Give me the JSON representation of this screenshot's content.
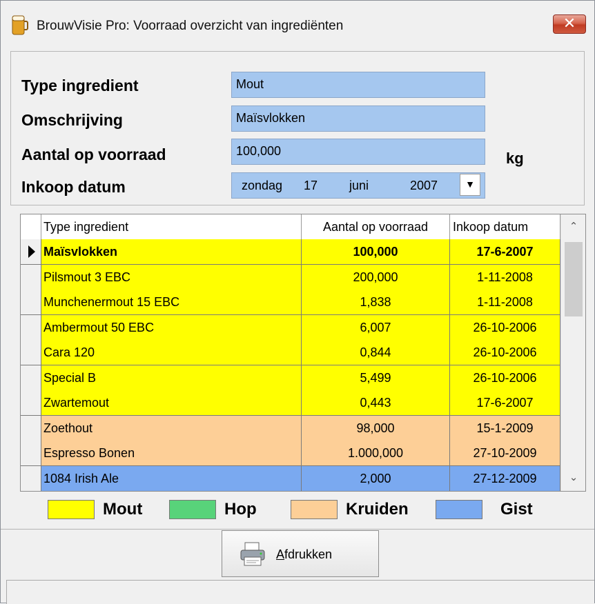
{
  "window": {
    "title": "BrouwVisie Pro: Voorraad overzicht van ingrediënten",
    "close_glyph": "✕"
  },
  "form": {
    "type_label": "Type ingredient",
    "type_value": "Mout",
    "desc_label": "Omschrijving",
    "desc_value": "Maïsvlokken",
    "qty_label": "Aantal op voorraad",
    "qty_value": "100,000",
    "qty_unit": "kg",
    "date_label": "Inkoop datum",
    "date": {
      "weekday": "zondag",
      "day": "17",
      "month": "juni",
      "year": "2007"
    }
  },
  "grid": {
    "columns": [
      "Type ingredient",
      "Aantal op voorraad",
      "Inkoop datum"
    ],
    "rows": [
      {
        "name": "Maïsvlokken",
        "qty": "100,000",
        "date": "17-6-2007",
        "category": "Mout",
        "selected": true
      },
      {
        "name": "Pilsmout 3 EBC",
        "qty": "200,000",
        "date": "1-11-2008",
        "category": "Mout"
      },
      {
        "name": "Munchenermout 15 EBC",
        "qty": "1,838",
        "date": "1-11-2008",
        "category": "Mout"
      },
      {
        "name": "Ambermout 50 EBC",
        "qty": "6,007",
        "date": "26-10-2006",
        "category": "Mout"
      },
      {
        "name": "Cara 120",
        "qty": "0,844",
        "date": "26-10-2006",
        "category": "Mout"
      },
      {
        "name": "Special B",
        "qty": "5,499",
        "date": "26-10-2006",
        "category": "Mout"
      },
      {
        "name": "Zwartemout",
        "qty": "0,443",
        "date": "17-6-2007",
        "category": "Mout"
      },
      {
        "name": "Zoethout",
        "qty": "98,000",
        "date": "15-1-2009",
        "category": "Kruiden"
      },
      {
        "name": "Espresso Bonen",
        "qty": "1.000,000",
        "date": "27-10-2009",
        "category": "Kruiden"
      },
      {
        "name": "1084 Irish Ale",
        "qty": "2,000",
        "date": "27-12-2009",
        "category": "Gist"
      }
    ]
  },
  "legend": [
    {
      "label": "Mout",
      "color": "#ffff00"
    },
    {
      "label": "Hop",
      "color": "#58d37a"
    },
    {
      "label": "Kruiden",
      "color": "#fdcf97"
    },
    {
      "label": "Gist",
      "color": "#7aa9f0"
    }
  ],
  "print_button": {
    "label": "Afdrukken"
  },
  "colors": {
    "field_bg": "#a5c7ef"
  }
}
